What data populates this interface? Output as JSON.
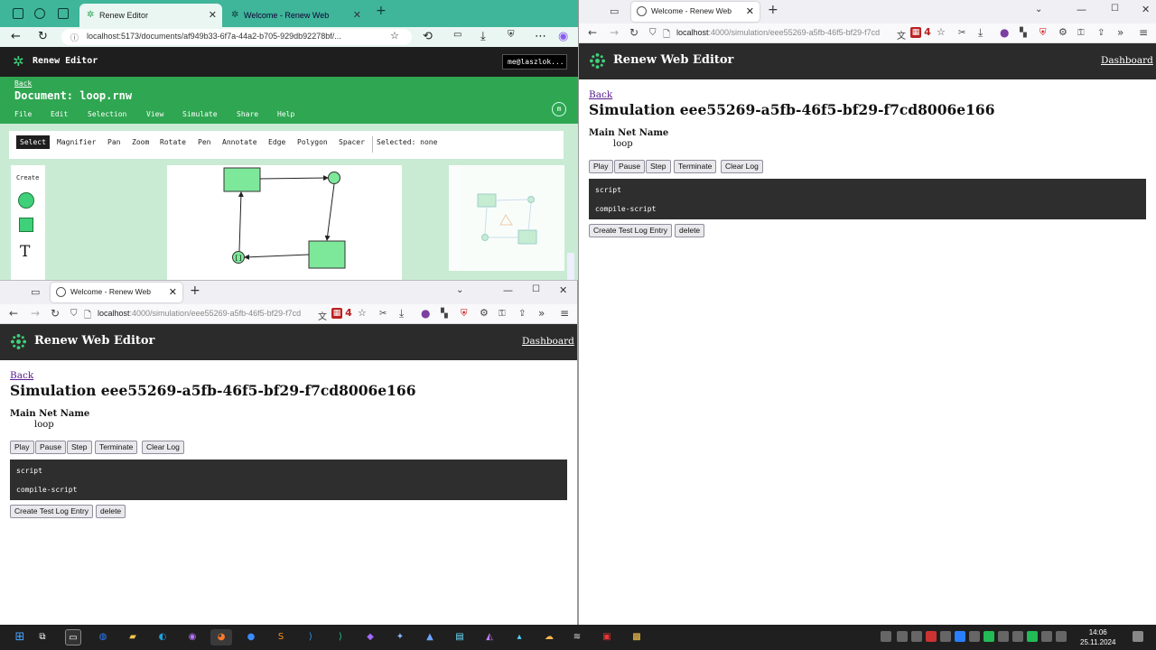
{
  "editor_window": {
    "tabs": [
      {
        "label": "Renew Editor"
      },
      {
        "label": "Welcome - Renew Web"
      }
    ],
    "url": "localhost:5173/documents/af949b33-6f7a-44a2-b705-929db92278bf/...",
    "app_title": "Renew Editor",
    "user": "me@laszlok...",
    "back_label": "Back",
    "document_title": "Document: loop.rnw",
    "menu": [
      "File",
      "Edit",
      "Selection",
      "View",
      "Simulate",
      "Share",
      "Help"
    ],
    "user_badge": "m",
    "tools": [
      "Select",
      "Magnifier",
      "Pan",
      "Zoom",
      "Rotate",
      "Pen",
      "Annotate",
      "Edge",
      "Polygon",
      "Spacer"
    ],
    "selected_status": "Selected: none",
    "create_label": "Create",
    "text_tool": "T",
    "transition_label": "[]",
    "accent_color": "#2fa651"
  },
  "sim_right": {
    "tab_label": "Welcome - Renew Web",
    "url_host": "localhost",
    "url_rest": ":4000/simulation/eee55269-a5fb-46f5-bf29-f7cd",
    "ext_badge": "4",
    "app_title": "Renew Web Editor",
    "dashboard_link": "Dashboard",
    "back_label": "Back",
    "title": "Simulation eee55269-a5fb-46f5-bf29-f7cd8006e166",
    "main_net_label": "Main Net Name",
    "main_net_value": "loop",
    "buttons": [
      "Play",
      "Pause",
      "Step",
      "Terminate",
      "Clear Log"
    ],
    "log_lines": [
      "script",
      "compile-script"
    ],
    "bottom_buttons": [
      "Create Test Log Entry",
      "delete"
    ]
  },
  "sim_left": {
    "tab_label": "Welcome - Renew Web",
    "url_host": "localhost",
    "url_rest": ":4000/simulation/eee55269-a5fb-46f5-bf29-f7cd",
    "ext_badge": "4",
    "app_title": "Renew Web Editor",
    "dashboard_link": "Dashboard",
    "back_label": "Back",
    "title": "Simulation eee55269-a5fb-46f5-bf29-f7cd8006e166",
    "main_net_label": "Main Net Name",
    "main_net_value": "loop",
    "buttons": [
      "Play",
      "Pause",
      "Step",
      "Terminate",
      "Clear Log"
    ],
    "log_lines": [
      "script",
      "compile-script"
    ],
    "bottom_buttons": [
      "Create Test Log Entry",
      "delete"
    ]
  },
  "taskbar": {
    "time": "14:06",
    "date": "25.11.2024"
  }
}
